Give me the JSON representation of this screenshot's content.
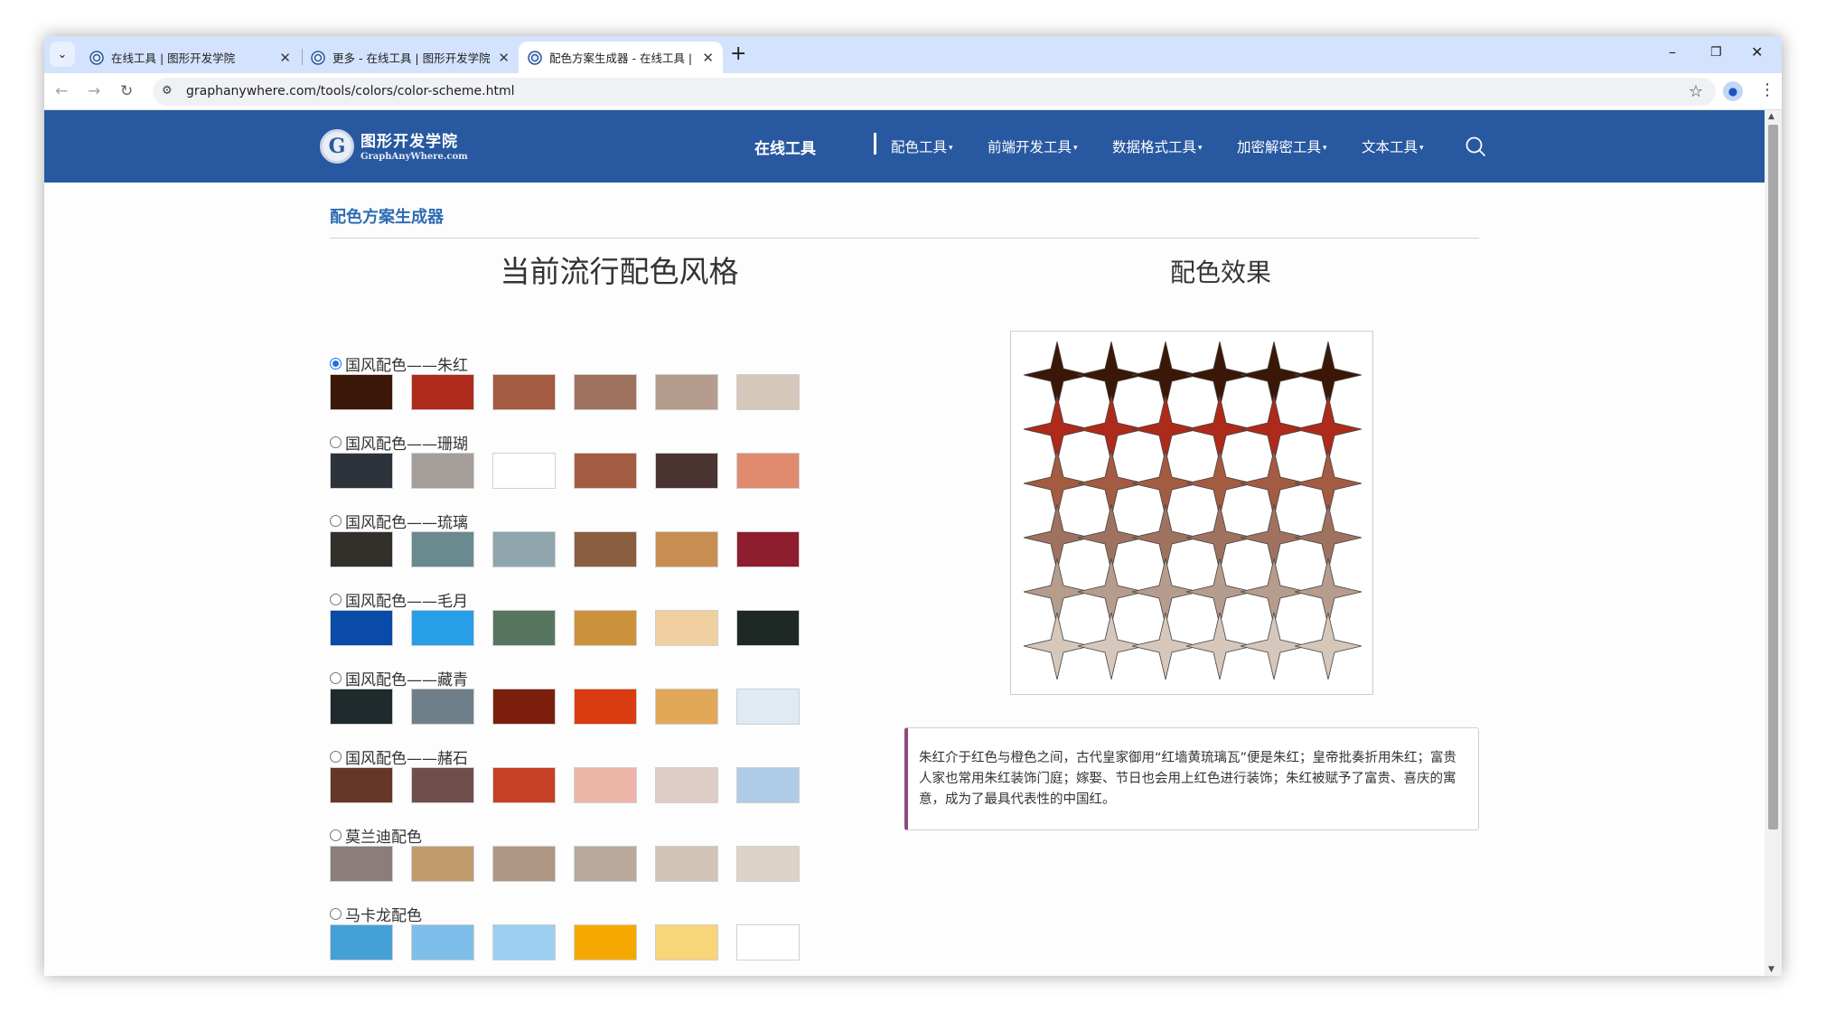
{
  "browser": {
    "tabs": [
      {
        "title": "在线工具 | 图形开发学院",
        "active": false
      },
      {
        "title": "更多 - 在线工具 | 图形开发学院",
        "active": false
      },
      {
        "title": "配色方案生成器 - 在线工具 | 图",
        "active": true
      }
    ],
    "close_glyph": "✕",
    "new_tab_glyph": "+",
    "url": "graphanywhere.com/tools/colors/color-scheme.html",
    "window_controls": [
      "–",
      "❐",
      "✕"
    ]
  },
  "site": {
    "logo_name": "图形开发学院",
    "logo_sub": "GraphAnyWhere.com",
    "logo_letter": "G",
    "nav_main": "在线工具",
    "nav_items": [
      "配色工具",
      "前端开发工具",
      "数据格式工具",
      "加密解密工具",
      "文本工具"
    ],
    "caret": "▾"
  },
  "page": {
    "title": "配色方案生成器",
    "left_heading": "当前流行配色风格",
    "right_heading": "配色效果",
    "schemes": [
      {
        "name": "国风配色——朱红",
        "checked": true,
        "colors": [
          "#3b1707",
          "#ae2a1a",
          "#a35b42",
          "#9f7260",
          "#b59c8d",
          "#d6c7bb"
        ]
      },
      {
        "name": "国风配色——珊瑚",
        "checked": false,
        "colors": [
          "#2c333b",
          "#a59d99",
          "#ffffff",
          "#a35b42",
          "#4a3331",
          "#e08b6d"
        ]
      },
      {
        "name": "国风配色——琉璃",
        "checked": false,
        "colors": [
          "#33302b",
          "#6a8a8f",
          "#8ea6ab",
          "#8a5e3e",
          "#c88d51",
          "#8e1d2d"
        ]
      },
      {
        "name": "国风配色——毛月",
        "checked": false,
        "colors": [
          "#0a4aa8",
          "#289ee9",
          "#567660",
          "#cc923b",
          "#f0cfa0",
          "#1e2925"
        ]
      },
      {
        "name": "国风配色——藏青",
        "checked": false,
        "colors": [
          "#1e2a2c",
          "#6f7f89",
          "#7b1e0c",
          "#db3b10",
          "#e1a857",
          "#dfeaf2"
        ]
      },
      {
        "name": "国风配色——赭石",
        "checked": false,
        "colors": [
          "#653728",
          "#6f4f4b",
          "#c73f25",
          "#eeb5a9",
          "#e0ccc6",
          "#aecbe7"
        ]
      },
      {
        "name": "莫兰迪配色",
        "checked": false,
        "colors": [
          "#8b7d7a",
          "#c09c6c",
          "#b09783",
          "#b8a99a",
          "#d2c4b4",
          "#ddd2c6"
        ]
      },
      {
        "name": "马卡龙配色",
        "checked": false,
        "colors": [
          "#45a0d8",
          "#7dbeea",
          "#9cd0f3",
          "#f5a900",
          "#f8d578",
          "#ffffff"
        ]
      }
    ],
    "preview_grid": {
      "columns": 6,
      "rows": 6
    },
    "description": "朱红介于红色与橙色之间，古代皇家御用“红墙黄琉璃瓦”便是朱红；皇帝批奏折用朱红；富贵人家也常用朱红装饰门庭；嫁娶、节日也会用上红色进行装饰；朱红被赋予了富贵、喜庆的寓意，成为了最具代表性的中国红。"
  }
}
